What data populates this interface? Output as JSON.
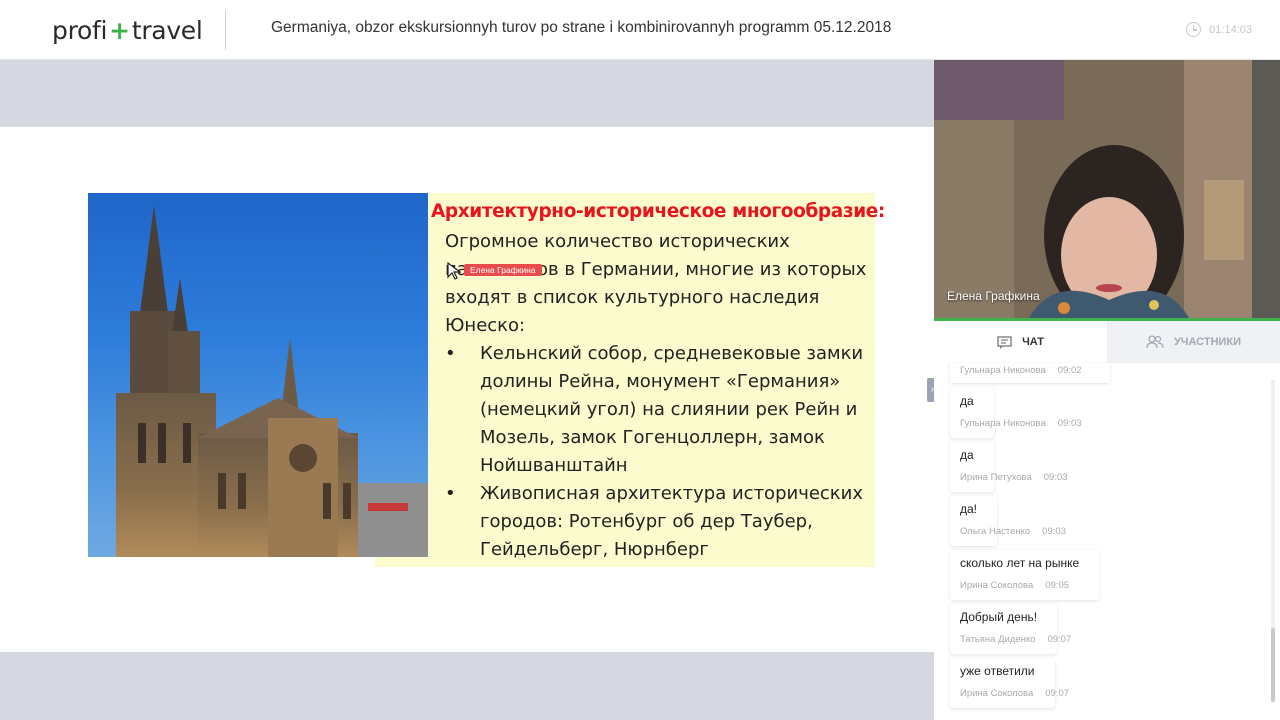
{
  "header": {
    "logo_left": "profi",
    "logo_plus": "+",
    "logo_right": "travel",
    "title": "Germaniya, obzor ekskursionnyh turov po strane i kombinirovannyh programm 05.12.2018",
    "timer": "01:14:03",
    "timer_icon": "clock-icon"
  },
  "slide": {
    "heading": "Архитектурно-историческое многообразие:",
    "paragraph": "Огромное количество исторических памятников в Германии, многие из которых входят в список культурного наследия Юнеско:",
    "bullets": [
      "Кельнский собор, средневековые замки долины Рейна, монумент «Германия» (немецкий угол) на слиянии рек Рейн и Мозель, замок Гогенцоллерн, замок Нойшванштайн",
      "Живописная архитектура исторических городов: Ротенбург об дер Таубер, Гейдельберг, Нюрнберг"
    ],
    "image_alt": "cologne-cathedral-photo",
    "cursor_label": "Елена Графкина"
  },
  "video": {
    "presenter_name": "Елена Графкина"
  },
  "tabs": {
    "chat": "ЧАТ",
    "participants": "УЧАСТНИКИ"
  },
  "chat": {
    "first_meta": {
      "author": "Гульнара Никонова",
      "time": "09:02"
    },
    "messages": [
      {
        "text": "да",
        "author": "Гульнара Никонова",
        "time": "09:03"
      },
      {
        "text": "да",
        "author": "Ирина Петухова",
        "time": "09:03"
      },
      {
        "text": "да!",
        "author": "Ольга Настенко",
        "time": "09:03"
      },
      {
        "text": "сколько лет на рынке",
        "author": "Ирина Соколова",
        "time": "09:05"
      },
      {
        "text": "Добрый день!",
        "author": "Татьяна Диденко",
        "time": "09:07"
      },
      {
        "text": "уже ответили",
        "author": "Ирина Соколова",
        "time": "09:07"
      }
    ]
  },
  "colors": {
    "accent_green": "#3db34a",
    "heading_red": "#e8141c",
    "slide_yellow": "#fbfbce",
    "cursor_red": "#e84c4c"
  }
}
